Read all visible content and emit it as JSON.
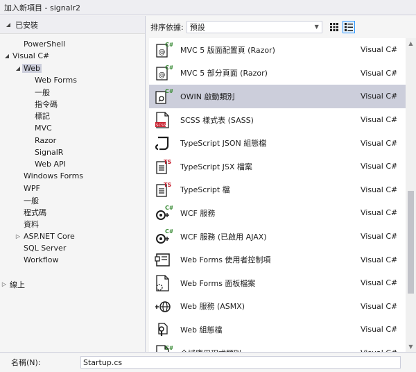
{
  "window": {
    "title": "加入新項目 - signalr2"
  },
  "sidebar": {
    "installed": "已安裝",
    "tree": [
      {
        "label": "PowerShell",
        "level": 1,
        "expander": ""
      },
      {
        "label": "Visual C#",
        "level": 0,
        "expander": "expanded"
      },
      {
        "label": "Web",
        "level": 1,
        "expander": "expanded",
        "selected": true
      },
      {
        "label": "Web Forms",
        "level": 2,
        "expander": ""
      },
      {
        "label": "一般",
        "level": 2,
        "expander": ""
      },
      {
        "label": "指令碼",
        "level": 2,
        "expander": ""
      },
      {
        "label": "標記",
        "level": 2,
        "expander": ""
      },
      {
        "label": "MVC",
        "level": 2,
        "expander": ""
      },
      {
        "label": "Razor",
        "level": 2,
        "expander": ""
      },
      {
        "label": "SignalR",
        "level": 2,
        "expander": ""
      },
      {
        "label": "Web API",
        "level": 2,
        "expander": ""
      },
      {
        "label": "Windows Forms",
        "level": 1,
        "expander": ""
      },
      {
        "label": "WPF",
        "level": 1,
        "expander": ""
      },
      {
        "label": "一般",
        "level": 1,
        "expander": ""
      },
      {
        "label": "程式碼",
        "level": 1,
        "expander": ""
      },
      {
        "label": "資料",
        "level": 1,
        "expander": ""
      },
      {
        "label": "ASP.NET Core",
        "level": 1,
        "expander": "collapsed"
      },
      {
        "label": "SQL Server",
        "level": 1,
        "expander": ""
      },
      {
        "label": "Workflow",
        "level": 1,
        "expander": ""
      },
      {
        "label": "",
        "level": 0,
        "expander": ""
      },
      {
        "label": "線上",
        "level": -1,
        "expander": "collapsed"
      }
    ]
  },
  "toolbar": {
    "sort_label": "排序依據:",
    "sort_value": "預設",
    "grid_view_icon": "grid-view-icon",
    "list_view_icon": "list-view-icon"
  },
  "templates": [
    {
      "name": "MVC 5 版面配置頁 (Razor)",
      "lang": "Visual C#",
      "icon": "razor-layout",
      "selected": false
    },
    {
      "name": "MVC 5 部分頁面 (Razor)",
      "lang": "Visual C#",
      "icon": "razor-partial",
      "selected": false
    },
    {
      "name": "OWIN 啟動類別",
      "lang": "Visual C#",
      "icon": "owin-class",
      "selected": true
    },
    {
      "name": "SCSS 樣式表 (SASS)",
      "lang": "Visual C#",
      "icon": "scss-file",
      "selected": false
    },
    {
      "name": "TypeScript JSON 組態檔",
      "lang": "Visual C#",
      "icon": "json-config",
      "selected": false
    },
    {
      "name": "TypeScript JSX 檔案",
      "lang": "Visual C#",
      "icon": "ts-file",
      "selected": false
    },
    {
      "name": "TypeScript 檔",
      "lang": "Visual C#",
      "icon": "ts-file",
      "selected": false
    },
    {
      "name": "WCF 服務",
      "lang": "Visual C#",
      "icon": "wcf-service",
      "selected": false
    },
    {
      "name": "WCF 服務 (已啟用 AJAX)",
      "lang": "Visual C#",
      "icon": "wcf-service",
      "selected": false
    },
    {
      "name": "Web Forms 使用者控制項",
      "lang": "Visual C#",
      "icon": "user-control",
      "selected": false
    },
    {
      "name": "Web Forms 面板檔案",
      "lang": "Visual C#",
      "icon": "skin-file",
      "selected": false
    },
    {
      "name": "Web 服務 (ASMX)",
      "lang": "Visual C#",
      "icon": "web-service",
      "selected": false
    },
    {
      "name": "Web 組態檔",
      "lang": "Visual C#",
      "icon": "web-config",
      "selected": false
    },
    {
      "name": "全域應用程式類別",
      "lang": "Visual C#",
      "icon": "global-class",
      "selected": false
    }
  ],
  "footer": {
    "name_label": "名稱(N):",
    "name_value": "Startup.cs"
  },
  "colors": {
    "selection": "#cccedb",
    "csharp_green": "#388a34",
    "ts_red": "#c8202f",
    "icon_dark": "#1e1e1e"
  }
}
